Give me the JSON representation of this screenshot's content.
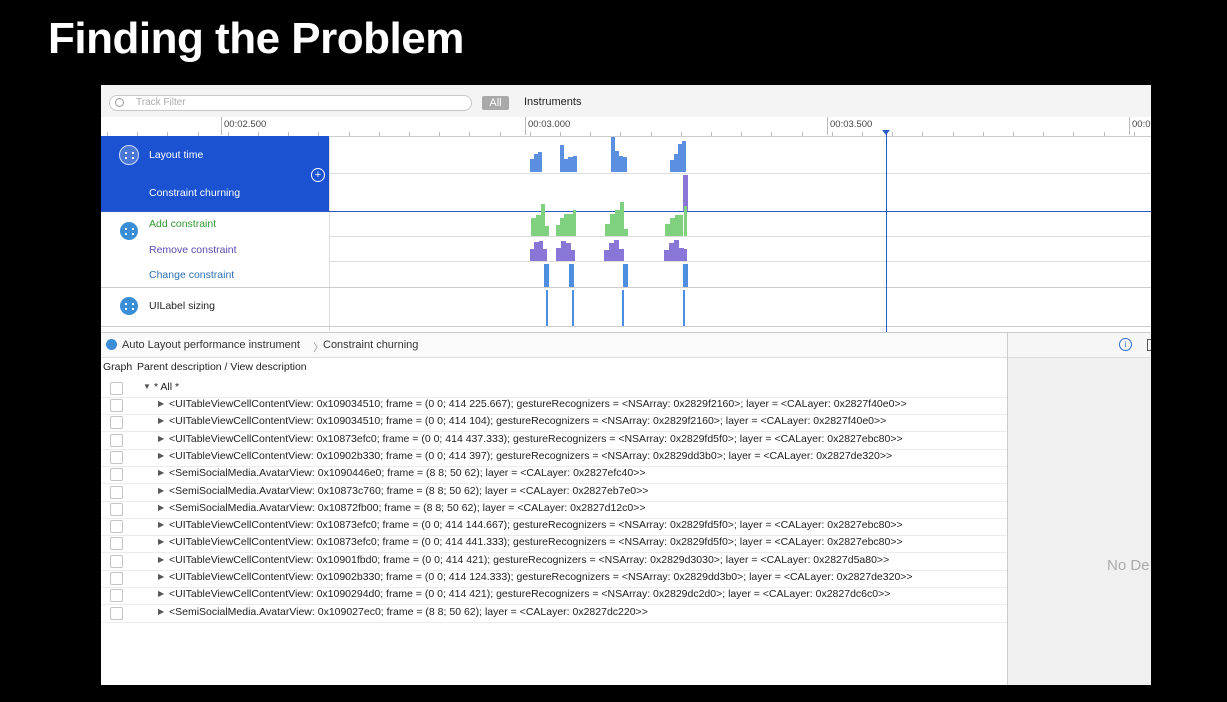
{
  "slide": {
    "title": "Finding the Problem"
  },
  "toolbar": {
    "filter_placeholder": "Track Filter",
    "all_label": "All",
    "instruments_label": "Instruments"
  },
  "ruler": {
    "ticks": [
      "00:02.500",
      "00:03.000",
      "00:03.500",
      "00:0"
    ]
  },
  "tracks": {
    "layout_time": "Layout time",
    "constraint_churning": "Constraint churning",
    "add_constraint": "Add constraint",
    "remove_constraint": "Remove constraint",
    "change_constraint": "Change constraint",
    "uilabel_sizing": "UILabel sizing"
  },
  "colors": {
    "selection": "#1a52d2",
    "layout": "#5b8fe0",
    "churn": "#8a76d6",
    "add": "#7fd07f",
    "remove": "#8a76d6",
    "change": "#4d8ee0",
    "sizing": "#4d8ee0",
    "add_label": "#2f9a2f",
    "remove_label": "#5a4ab0",
    "change_label": "#2a6fb3"
  },
  "pathbar": {
    "instrument": "Auto Layout performance instrument",
    "sep": "〉",
    "current": "Constraint churning"
  },
  "inspector": {
    "empty": "No De",
    "info_icon": "i"
  },
  "table": {
    "headers": {
      "graph": "Graph",
      "desc": "Parent description / View description"
    },
    "root": "* All *",
    "rows": [
      "<UITableViewCellContentView: 0x109034510; frame = (0 0; 414 225.667); gestureRecognizers = <NSArray: 0x2829f2160>; layer = <CALayer: 0x2827f40e0>>",
      "<UITableViewCellContentView: 0x109034510; frame = (0 0; 414 104); gestureRecognizers = <NSArray: 0x2829f2160>; layer = <CALayer: 0x2827f40e0>>",
      "<UITableViewCellContentView: 0x10873efc0; frame = (0 0; 414 437.333); gestureRecognizers = <NSArray: 0x2829fd5f0>; layer = <CALayer: 0x2827ebc80>>",
      "<UITableViewCellContentView: 0x10902b330; frame = (0 0; 414 397); gestureRecognizers = <NSArray: 0x2829dd3b0>; layer = <CALayer: 0x2827de320>>",
      "<SemiSocialMedia.AvatarView: 0x1090446e0; frame = (8 8; 50 62); layer = <CALayer: 0x2827efc40>>",
      "<SemiSocialMedia.AvatarView: 0x10873c760; frame = (8 8; 50 62); layer = <CALayer: 0x2827eb7e0>>",
      "<SemiSocialMedia.AvatarView: 0x10872fb00; frame = (8 8; 50 62); layer = <CALayer: 0x2827d12c0>>",
      "<UITableViewCellContentView: 0x10873efc0; frame = (0 0; 414 144.667); gestureRecognizers = <NSArray: 0x2829fd5f0>; layer = <CALayer: 0x2827ebc80>>",
      "<UITableViewCellContentView: 0x10873efc0; frame = (0 0; 414 441.333); gestureRecognizers = <NSArray: 0x2829fd5f0>; layer = <CALayer: 0x2827ebc80>>",
      "<UITableViewCellContentView: 0x10901fbd0; frame = (0 0; 414 421); gestureRecognizers = <NSArray: 0x2829d3030>; layer = <CALayer: 0x2827d5a80>>",
      "<UITableViewCellContentView: 0x10902b330; frame = (0 0; 414 124.333); gestureRecognizers = <NSArray: 0x2829dd3b0>; layer = <CALayer: 0x2827de320>>",
      "<UITableViewCellContentView: 0x1090294d0; frame = (0 0; 414 421); gestureRecognizers = <NSArray: 0x2829dc2d0>; layer = <CALayer: 0x2827dc6c0>>",
      "<SemiSocialMedia.AvatarView: 0x109027ec0; frame = (8 8; 50 62); layer = <CALayer: 0x2827dc220>>"
    ]
  }
}
